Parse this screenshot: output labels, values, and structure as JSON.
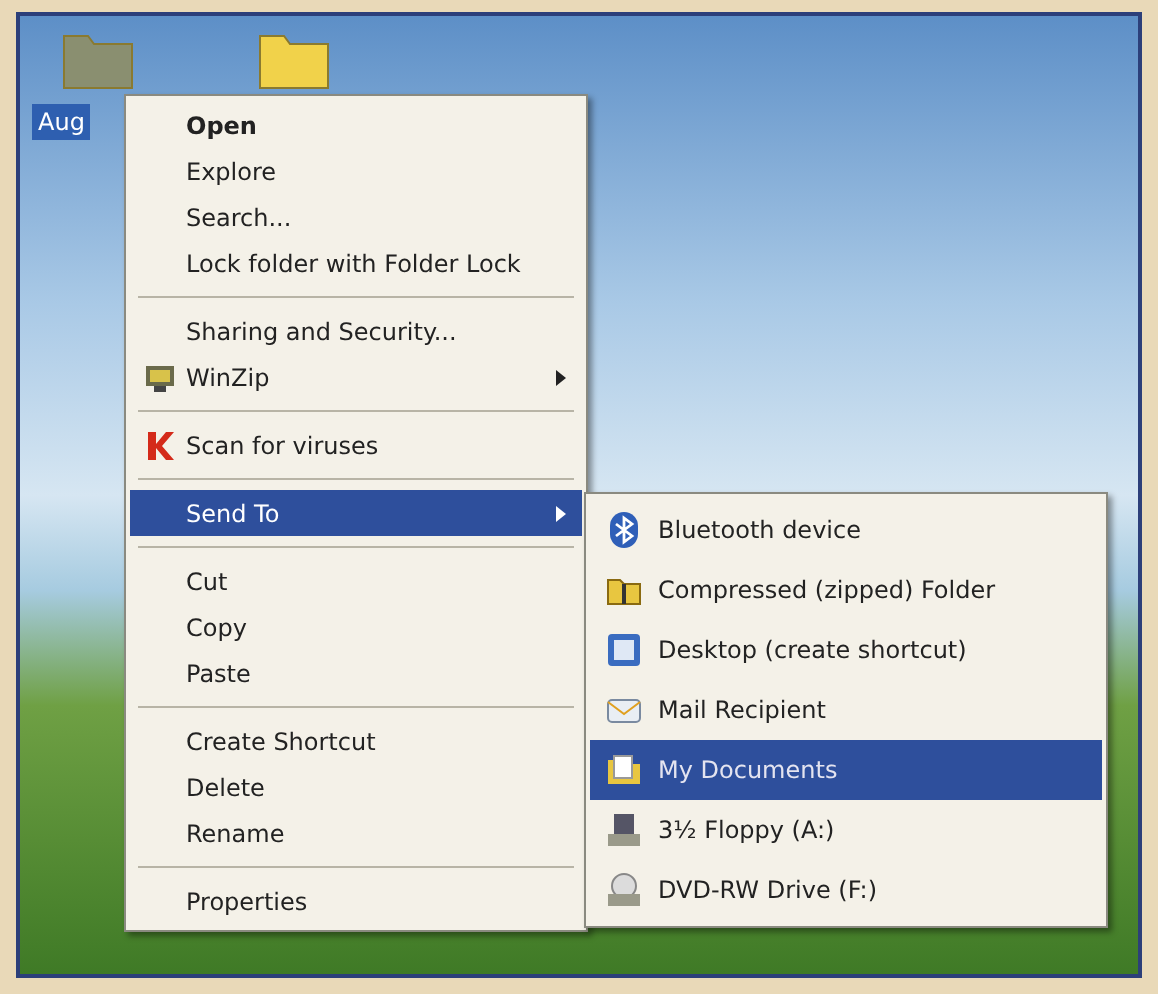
{
  "desktop": {
    "icons": [
      {
        "label": "Aug",
        "selected": true,
        "kind": "folder-grey"
      },
      {
        "kind": "folder"
      }
    ]
  },
  "context_menu": {
    "groups": [
      [
        {
          "label": "Open",
          "bold": true,
          "selected": false
        },
        {
          "label": "Explore",
          "selected": false
        },
        {
          "label": "Search...",
          "selected": false
        },
        {
          "label": "Lock folder with Folder Lock",
          "selected": false
        }
      ],
      [
        {
          "label": "Sharing and Security...",
          "selected": false
        },
        {
          "label": "WinZip",
          "kind": "winzip",
          "submenu": true,
          "selected": false
        }
      ],
      [
        {
          "label": "Scan for viruses",
          "kind": "antivirus",
          "selected": false
        }
      ],
      [
        {
          "label": "Send To",
          "submenu": true,
          "selected": true
        }
      ],
      [
        {
          "label": "Cut",
          "selected": false
        },
        {
          "label": "Copy",
          "selected": false
        },
        {
          "label": "Paste",
          "selected": false
        }
      ],
      [
        {
          "label": "Create Shortcut",
          "selected": false
        },
        {
          "label": "Delete",
          "selected": false
        },
        {
          "label": "Rename",
          "selected": false
        }
      ],
      [
        {
          "label": "Properties",
          "selected": false
        }
      ]
    ]
  },
  "send_to_menu": {
    "items": [
      {
        "label": "Bluetooth device",
        "kind": "bluetooth",
        "selected": false
      },
      {
        "label": "Compressed (zipped) Folder",
        "kind": "zip",
        "selected": false
      },
      {
        "label": "Desktop (create shortcut)",
        "kind": "desktop",
        "selected": false
      },
      {
        "label": "Mail Recipient",
        "kind": "mail",
        "selected": false
      },
      {
        "label": "My Documents",
        "kind": "documents",
        "selected": true
      },
      {
        "label": "3½ Floppy (A:)",
        "kind": "floppy",
        "selected": false
      },
      {
        "label": "DVD-RW Drive (F:)",
        "kind": "dvd",
        "selected": false
      }
    ]
  }
}
